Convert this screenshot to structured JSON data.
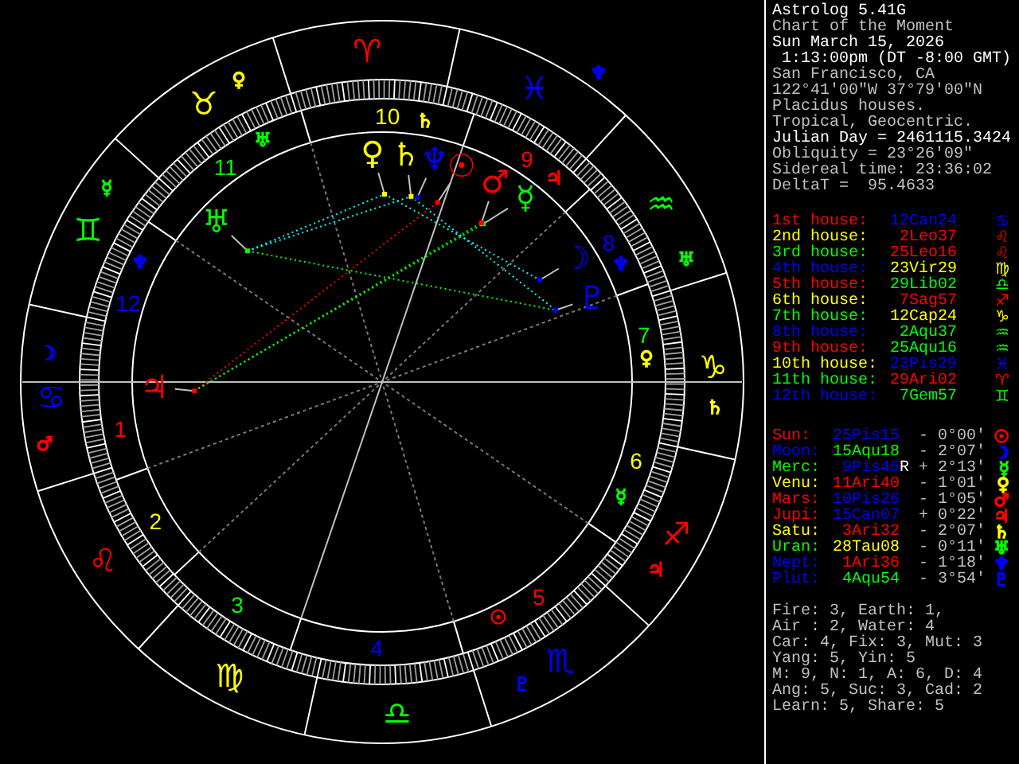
{
  "header": [
    {
      "text": "Astrolog 5.41G",
      "color": "#ffffff"
    },
    {
      "text": "Chart of the Moment",
      "color": "#c0c0c0"
    },
    {
      "text": "Sun March 15, 2026",
      "color": "#ffffff"
    },
    {
      "text": " 1:13:00pm (DT -8:00 GMT)",
      "color": "#ffffff"
    },
    {
      "text": "San Francisco, CA",
      "color": "#c0c0c0"
    },
    {
      "text": "122°41'00\"W 37°79'00\"N",
      "color": "#c0c0c0"
    },
    {
      "text": "Placidus houses.",
      "color": "#c0c0c0"
    },
    {
      "text": "Tropical, Geocentric.",
      "color": "#c0c0c0"
    },
    {
      "text": "Julian Day = 2461115.3424",
      "color": "#ffffff"
    },
    {
      "text": "Obliquity = 23°26'09\"",
      "color": "#c0c0c0"
    },
    {
      "text": "Sidereal time: 23:36:02",
      "color": "#c0c0c0"
    },
    {
      "text": "DeltaT =  95.4633",
      "color": "#c0c0c0"
    }
  ],
  "houses": [
    {
      "label": "1st house:",
      "color": "#ff0000",
      "cusp": {
        "text": "12Can24",
        "color": "#0000ff"
      },
      "sign": {
        "glyph": "♋",
        "color": "#0000ff"
      }
    },
    {
      "label": "2nd house:",
      "color": "#ffff00",
      "cusp": {
        "text": "2Leo37",
        "color": "#ff0000"
      },
      "sign": {
        "glyph": "♌",
        "color": "#ff0000"
      }
    },
    {
      "label": "3rd house:",
      "color": "#00ff00",
      "cusp": {
        "text": "25Leo16",
        "color": "#ff0000"
      },
      "sign": {
        "glyph": "♌",
        "color": "#ff0000"
      }
    },
    {
      "label": "4th house:",
      "color": "#0000ff",
      "cusp": {
        "text": "23Vir29",
        "color": "#ffff00"
      },
      "sign": {
        "glyph": "♍",
        "color": "#ffff00"
      }
    },
    {
      "label": "5th house:",
      "color": "#ff0000",
      "cusp": {
        "text": "29Lib02",
        "color": "#00ff00"
      },
      "sign": {
        "glyph": "♎",
        "color": "#00ff00"
      }
    },
    {
      "label": "6th house:",
      "color": "#ffff00",
      "cusp": {
        "text": "7Sag57",
        "color": "#ff0000"
      },
      "sign": {
        "glyph": "♐",
        "color": "#ff0000"
      }
    },
    {
      "label": "7th house:",
      "color": "#00ff00",
      "cusp": {
        "text": "12Cap24",
        "color": "#ffff00"
      },
      "sign": {
        "glyph": "♑",
        "color": "#ffff00"
      }
    },
    {
      "label": "8th house:",
      "color": "#0000ff",
      "cusp": {
        "text": "2Aqu37",
        "color": "#00ff00"
      },
      "sign": {
        "glyph": "♒",
        "color": "#00ff00"
      }
    },
    {
      "label": "9th house:",
      "color": "#ff0000",
      "cusp": {
        "text": "25Aqu16",
        "color": "#00ff00"
      },
      "sign": {
        "glyph": "♒",
        "color": "#00ff00"
      }
    },
    {
      "label": "10th house:",
      "color": "#ffff00",
      "cusp": {
        "text": "23Pis29",
        "color": "#0000ff"
      },
      "sign": {
        "glyph": "♓",
        "color": "#0000ff"
      }
    },
    {
      "label": "11th house:",
      "color": "#00ff00",
      "cusp": {
        "text": "29Ari02",
        "color": "#ff0000"
      },
      "sign": {
        "glyph": "♈",
        "color": "#ff0000"
      }
    },
    {
      "label": "12th house:",
      "color": "#0000ff",
      "cusp": {
        "text": "7Gem57",
        "color": "#00ff00"
      },
      "sign": {
        "glyph": "♊",
        "color": "#00ff00"
      }
    }
  ],
  "planets": [
    {
      "label": "Sun:",
      "color": "#ff0000",
      "position": {
        "text": "25Pis15",
        "color": "#0000ff"
      },
      "retrograde": false,
      "direction": "-",
      "deviation": "0°00'",
      "symbol": {
        "glyph": "☉",
        "color": "#ff0000"
      }
    },
    {
      "label": "Moon:",
      "color": "#0000ff",
      "position": {
        "text": "15Aqu18",
        "color": "#00ff00"
      },
      "retrograde": false,
      "direction": "-",
      "deviation": "2°07'",
      "symbol": {
        "glyph": "☽",
        "color": "#0000ff"
      }
    },
    {
      "label": "Merc:",
      "color": "#00ff00",
      "position": {
        "text": "9Pis46",
        "color": "#0000ff"
      },
      "retrograde": true,
      "retrograde_mark": "R",
      "direction": "+",
      "deviation": "2°13'",
      "symbol": {
        "glyph": "☿",
        "color": "#00ff00"
      }
    },
    {
      "label": "Venu:",
      "color": "#ffff00",
      "position": {
        "text": "11Ari40",
        "color": "#ff0000"
      },
      "retrograde": false,
      "direction": "-",
      "deviation": "1°01'",
      "symbol": {
        "glyph": "♀",
        "color": "#ffff00"
      }
    },
    {
      "label": "Mars:",
      "color": "#ff0000",
      "position": {
        "text": "10Pis26",
        "color": "#0000ff"
      },
      "retrograde": false,
      "direction": "-",
      "deviation": "1°05'",
      "symbol": {
        "glyph": "♂",
        "color": "#ff0000"
      }
    },
    {
      "label": "Jupi:",
      "color": "#ff0000",
      "position": {
        "text": "15Can07",
        "color": "#0000ff"
      },
      "retrograde": false,
      "direction": "+",
      "deviation": "0°22'",
      "symbol": {
        "glyph": "♃",
        "color": "#ff0000"
      }
    },
    {
      "label": "Satu:",
      "color": "#ffff00",
      "position": {
        "text": "3Ari32",
        "color": "#ff0000"
      },
      "retrograde": false,
      "direction": "-",
      "deviation": "2°07'",
      "symbol": {
        "glyph": "♄",
        "color": "#ffff00"
      }
    },
    {
      "label": "Uran:",
      "color": "#00ff00",
      "position": {
        "text": "28Tau08",
        "color": "#ffff00"
      },
      "retrograde": false,
      "direction": "-",
      "deviation": "0°11'",
      "symbol": {
        "glyph": "♅",
        "color": "#00ff00"
      }
    },
    {
      "label": "Nept:",
      "color": "#0000ff",
      "position": {
        "text": "1Ari36",
        "color": "#ff0000"
      },
      "retrograde": false,
      "direction": "-",
      "deviation": "1°18'",
      "symbol": {
        "glyph": "♆",
        "color": "#0000ff"
      }
    },
    {
      "label": "Plut:",
      "color": "#0000ff",
      "position": {
        "text": "4Aqu54",
        "color": "#00ff00"
      },
      "retrograde": false,
      "direction": "-",
      "deviation": "3°54'",
      "symbol": {
        "glyph": "♇",
        "color": "#0000ff"
      }
    }
  ],
  "stats": [
    "Fire: 3, Earth: 1,",
    "Air : 2, Water: 4",
    "Car: 4, Fix: 3, Mut: 3",
    "Yang: 5, Yin: 5",
    "M: 9, N: 1, A: 6, D: 4",
    "Ang: 5, Suc: 3, Cad: 2",
    "Learn: 5, Share: 5"
  ],
  "wheel": {
    "signs": [
      {
        "glyph": "♈",
        "color": "#ff0000"
      },
      {
        "glyph": "♉",
        "color": "#ffff00"
      },
      {
        "glyph": "♊",
        "color": "#00ff00"
      },
      {
        "glyph": "♋",
        "color": "#0000ff"
      },
      {
        "glyph": "♌",
        "color": "#ff0000"
      },
      {
        "glyph": "♍",
        "color": "#ffff00"
      },
      {
        "glyph": "♎",
        "color": "#00ff00"
      },
      {
        "glyph": "♏",
        "color": "#0000ff"
      },
      {
        "glyph": "♐",
        "color": "#ff0000"
      },
      {
        "glyph": "♑",
        "color": "#ffff00"
      },
      {
        "glyph": "♒",
        "color": "#00ff00"
      },
      {
        "glyph": "♓",
        "color": "#0000ff"
      }
    ],
    "house_numbers": [
      {
        "text": "1",
        "color": "#ff0000"
      },
      {
        "text": "2",
        "color": "#ffff00"
      },
      {
        "text": "3",
        "color": "#00ff00"
      },
      {
        "text": "4",
        "color": "#0000ff"
      },
      {
        "text": "5",
        "color": "#ff0000"
      },
      {
        "text": "6",
        "color": "#ffff00"
      },
      {
        "text": "7",
        "color": "#00ff00"
      },
      {
        "text": "8",
        "color": "#0000ff"
      },
      {
        "text": "9",
        "color": "#ff0000"
      },
      {
        "text": "10",
        "color": "#ffff00"
      },
      {
        "text": "11",
        "color": "#00ff00"
      },
      {
        "text": "12",
        "color": "#0000ff"
      }
    ],
    "planets": [
      {
        "glyph": "☉",
        "color": "#ff0000"
      },
      {
        "glyph": "☽",
        "color": "#0000ff"
      },
      {
        "glyph": "☿",
        "color": "#00ff00"
      },
      {
        "glyph": "♀",
        "color": "#ffff00"
      },
      {
        "glyph": "♂",
        "color": "#ff0000"
      },
      {
        "glyph": "♃",
        "color": "#ff0000"
      },
      {
        "glyph": "♄",
        "color": "#ffff00"
      },
      {
        "glyph": "♅",
        "color": "#00ff00"
      },
      {
        "glyph": "♆",
        "color": "#0000ff"
      },
      {
        "glyph": "♇",
        "color": "#0000ff"
      }
    ],
    "minor_glyphs": [
      {
        "glyph": "♄",
        "color": "#ffff00"
      },
      {
        "glyph": "♅",
        "color": "#00ff00"
      },
      {
        "glyph": "♃",
        "color": "#ff0000"
      },
      {
        "glyph": "♆",
        "color": "#0000ff"
      },
      {
        "glyph": "♆",
        "color": "#0000ff"
      },
      {
        "glyph": "♅",
        "color": "#00ff00"
      },
      {
        "glyph": "♀",
        "color": "#ffff00"
      },
      {
        "glyph": "☿",
        "color": "#00ff00"
      },
      {
        "glyph": "♆",
        "color": "#0000ff"
      },
      {
        "glyph": "☽",
        "color": "#0000ff"
      },
      {
        "glyph": "♂",
        "color": "#ff0000"
      },
      {
        "glyph": "♀",
        "color": "#ffff00"
      },
      {
        "glyph": "♄",
        "color": "#ffff00"
      },
      {
        "glyph": "☿",
        "color": "#00ff00"
      },
      {
        "glyph": "♃",
        "color": "#ff0000"
      },
      {
        "glyph": "☉",
        "color": "#ff0000"
      },
      {
        "glyph": "♇",
        "color": "#0000ff"
      }
    ]
  }
}
